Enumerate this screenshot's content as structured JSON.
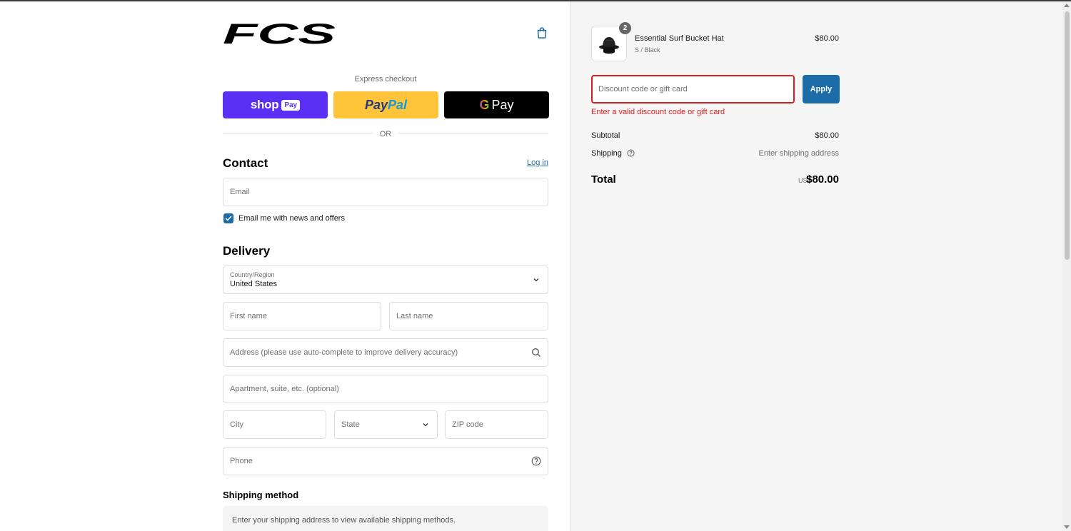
{
  "brand": {
    "logo_text": "FCS"
  },
  "express": {
    "label": "Express checkout",
    "shop_text": "shop",
    "shop_pill": "Pay",
    "paypal_pay": "Pay",
    "paypal_pal": "Pal",
    "gpay_g": "G",
    "gpay_text": "Pay"
  },
  "divider": {
    "or": "OR"
  },
  "contact": {
    "heading": "Contact",
    "login_link": "Log in",
    "email_placeholder": "Email",
    "newsletter_label": "Email me with news and offers",
    "newsletter_checked": true
  },
  "delivery": {
    "heading": "Delivery",
    "country_label": "Country/Region",
    "country_value": "United States",
    "first_name_placeholder": "First name",
    "last_name_placeholder": "Last name",
    "address_placeholder": "Address (please use auto-complete to improve delivery accuracy)",
    "apartment_placeholder": "Apartment, suite, etc. (optional)",
    "city_placeholder": "City",
    "state_placeholder": "State",
    "zip_placeholder": "ZIP code",
    "phone_placeholder": "Phone"
  },
  "shipping_method": {
    "heading": "Shipping method",
    "message": "Enter your shipping address to view available shipping methods."
  },
  "order": {
    "item": {
      "name": "Essential Surf Bucket Hat",
      "variant": "S / Black",
      "price": "$80.00",
      "quantity": "2"
    },
    "discount_placeholder": "Discount code or gift card",
    "apply_label": "Apply",
    "discount_error": "Enter a valid discount code or gift card",
    "subtotal_label": "Subtotal",
    "subtotal_value": "$80.00",
    "shipping_label": "Shipping",
    "shipping_value": "Enter shipping address",
    "total_label": "Total",
    "total_currency": "USD",
    "total_value": "$80.00"
  },
  "colors": {
    "accent": "#1c6ca8",
    "error": "#dd1d1d",
    "shop_pay": "#5a31f4",
    "paypal": "#ffc439",
    "gpay": "#000000"
  }
}
